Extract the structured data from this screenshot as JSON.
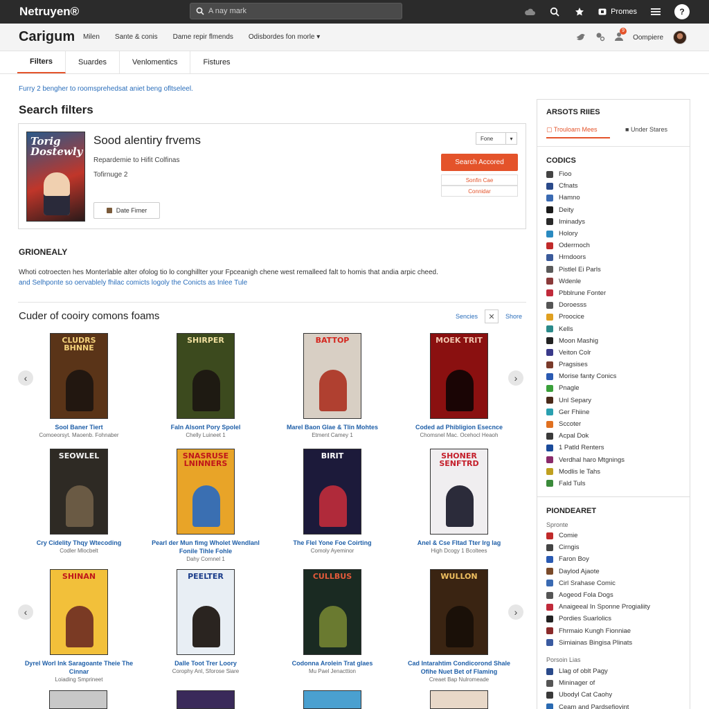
{
  "topbar": {
    "brand": "Netruyen®",
    "search_placeholder": "A nay mark",
    "promo_label": "Promes"
  },
  "subheader": {
    "site_title": "Carigum",
    "nav": [
      "Milen",
      "Sante & conis",
      "Dame repir flmends",
      "Odisbordes fon morle ▾"
    ],
    "user_label": "Oompiere",
    "notif_count": "9"
  },
  "tabs": [
    "Filters",
    "Suardes",
    "Venlomentics",
    "Fistures"
  ],
  "main": {
    "hint": "Furry 2 bengher to roomsprehedsat aniet beng ofltseleel.",
    "search_heading": "Search filters",
    "filter": {
      "cover_title": "Torig Dostewly",
      "title": "Sood alentiry frvems",
      "line1": "Repardemie to Hifit Colfinas",
      "line2": "Tofirnuge 2",
      "date_button": "Date Fimer",
      "sort_value": "Fone",
      "primary_button": "Search Accored",
      "secondary_button1": "Sonfin Cae",
      "secondary_button2": "Connidar"
    },
    "general_heading": "GRIONEALY",
    "general_line1": "Whoti cotroecten hes Monterlable alter ofolog tio lo conghillter your Fpceanigh chene west remalleed falt to homis that andia arpic cheed.",
    "general_line2": "and Selhponte so oervablely fhilac comicts logoly the Conicts as Inlee Tule",
    "grid_heading": "Cuder of cooiry comons foams",
    "grid_link1": "Sencies",
    "grid_link2": "Shore",
    "comics": [
      {
        "cover": "CLUDRS BHNNE",
        "title": "Sool Baner Tiert",
        "sub": "Comoeorsyt. Maoenb. Fohnaber",
        "bg": "#5a3418",
        "fg": "#f4d27a",
        "fig": "#221710"
      },
      {
        "cover": "SHIRPER",
        "title": "Faln Alsont Pory Spolel",
        "sub": "Chelly Luineet 1",
        "bg": "#3c4a1e",
        "fg": "#f1e0a0",
        "fig": "#1e1a12"
      },
      {
        "cover": "BATTOP",
        "title": "Marel Baon Glae & Tlin Mohtes",
        "sub": "Etment Camey 1",
        "bg": "#d8cfc4",
        "fg": "#d4261e",
        "fig": "#b04030"
      },
      {
        "cover": "MOEK TRIT",
        "title": "Coded ad Phibligion Esecnce",
        "sub": "Chomsnel Mac. Ocehocl Heaoh",
        "bg": "#8a1010",
        "fg": "#f2c6b0",
        "fig": "#1a0505"
      },
      {
        "cover": "SEOWLEL",
        "title": "Cry Cidelity Thqy Wtecoding",
        "sub": "Codler Mlocbelt",
        "bg": "#2e2a24",
        "fg": "#f4f4f4",
        "fig": "#6a5a44"
      },
      {
        "cover": "SNASRUSE LNINNERS",
        "title": "Pearl der Mun fimg Wholet Wendlanl Fonile Tihle Fohle",
        "sub": "Dahy Cornnel 1",
        "bg": "#e8a428",
        "fg": "#c0161a",
        "fig": "#3a6fb2"
      },
      {
        "cover": "BIRIT",
        "title": "The Flel Yone Foe Coirting",
        "sub": "Comoly Ayeminor",
        "bg": "#1c1a3a",
        "fg": "#ffffff",
        "fig": "#b02a3a"
      },
      {
        "cover": "SHONER SENFTRD",
        "title": "Anel & Cse Fltad Tter Irg lag",
        "sub": "High Dcogy 1 Bcoltees",
        "bg": "#f0eef0",
        "fg": "#c41e2a",
        "fig": "#2b2b3a"
      },
      {
        "cover": "SHINAN",
        "title": "Dyrel Worl Ink Saragoante Theie The Cinnar",
        "sub": "Loiading Smprineet",
        "bg": "#f2c03a",
        "fg": "#c0161a",
        "fig": "#7a3a24"
      },
      {
        "cover": "PEELTER",
        "title": "Dalle Toot Trer Loory",
        "sub": "Corophy Anl, Sforose Siare",
        "bg": "#e8eef4",
        "fg": "#1a3c8a",
        "fig": "#2a2420"
      },
      {
        "cover": "CULLBUS",
        "title": "Codonna Arolein Trat glaes",
        "sub": "Mu Pael Jenacttion",
        "bg": "#1a2a22",
        "fg": "#e45a3a",
        "fig": "#6a7a30"
      },
      {
        "cover": "WULLON",
        "title": "Cad Intarahtim Condicorond Shale Ofihe Nuet Bet of Flaming",
        "sub": "Creaet Bap Nulromeade",
        "bg": "#3a2412",
        "fg": "#f0c060",
        "fig": "#1a1008"
      }
    ]
  },
  "sidebar": {
    "heading": "ARSOTS RIIES",
    "tab1": "Trouloarn Mees",
    "tab2": "Under Stares",
    "sub1": "CODICS",
    "list1": [
      {
        "label": "Fioo",
        "color": "#444444"
      },
      {
        "label": "Cfnats",
        "color": "#2a4a8a"
      },
      {
        "label": "Hamno",
        "color": "#3a6ab2"
      },
      {
        "label": "Deity",
        "color": "#1a1a1a"
      },
      {
        "label": "Iminadys",
        "color": "#2a2a2a"
      },
      {
        "label": "Holory",
        "color": "#2a8ac0"
      },
      {
        "label": "Oderrnoch",
        "color": "#c02a2a"
      },
      {
        "label": "Hrndoors",
        "color": "#3a5a9a"
      },
      {
        "label": "Pistlel Ei Parls",
        "color": "#5a5a5a"
      },
      {
        "label": "Wdenle",
        "color": "#8a3a3a"
      },
      {
        "label": "Pbblrune Fonter",
        "color": "#c02a3a"
      },
      {
        "label": "Doroesss",
        "color": "#555555"
      },
      {
        "label": "Proocice",
        "color": "#e0a020"
      },
      {
        "label": "Kells",
        "color": "#2a8a8a"
      },
      {
        "label": "Moon Mashig",
        "color": "#222222"
      },
      {
        "label": "Veiton Colr",
        "color": "#3a3a8a"
      },
      {
        "label": "Pragsises",
        "color": "#7a3a2a"
      },
      {
        "label": "Morise fanty Conics",
        "color": "#2a5ab2"
      },
      {
        "label": "Pnagle",
        "color": "#3aa03a"
      },
      {
        "label": "Unl Separy",
        "color": "#4a2a1a"
      },
      {
        "label": "Ger Fhiine",
        "color": "#2aa0b0"
      },
      {
        "label": "Sccoter",
        "color": "#e07020"
      },
      {
        "label": "Acpal Dok",
        "color": "#3a3a3a"
      },
      {
        "label": "1 Patld Renters",
        "color": "#1a4a9a"
      },
      {
        "label": "Verdhal haro Mtgnings",
        "color": "#8a2a6a"
      },
      {
        "label": "Modlis le Tahs",
        "color": "#c0a020"
      },
      {
        "label": "Fald Tuls",
        "color": "#3a8a3a"
      }
    ],
    "sub2": "PIONDEARET",
    "caption1": "Spronte",
    "list2": [
      {
        "label": "Comie",
        "color": "#c02a2a"
      },
      {
        "label": "Cirngis",
        "color": "#444444"
      },
      {
        "label": "Faron Boy",
        "color": "#2a5ab2"
      },
      {
        "label": "Daylod Ajaote",
        "color": "#7a4a2a"
      },
      {
        "label": "Cirl Srahase Comic",
        "color": "#3a6ab2"
      },
      {
        "label": "Aogeod Fola Dogs",
        "color": "#555555"
      },
      {
        "label": "Anaigeeal In Sponne Progialiity",
        "color": "#c02a3a"
      },
      {
        "label": "Pordies Suarlolics",
        "color": "#222222"
      },
      {
        "label": "Fhrmaio Kungh Fionniae",
        "color": "#8a2a2a"
      },
      {
        "label": "Simiainas Bingisa Plinats",
        "color": "#3a5aa0"
      }
    ],
    "caption2": "Porsoin Lias",
    "list3": [
      {
        "label": "Llag of oblt Pagy",
        "color": "#2a4a8a"
      },
      {
        "label": "Mininager of",
        "color": "#555555"
      },
      {
        "label": "Ubodyl Cat Caohy",
        "color": "#3a3a3a"
      },
      {
        "label": "Ceam and Pardsefiovint",
        "color": "#2a6ab2"
      }
    ]
  }
}
